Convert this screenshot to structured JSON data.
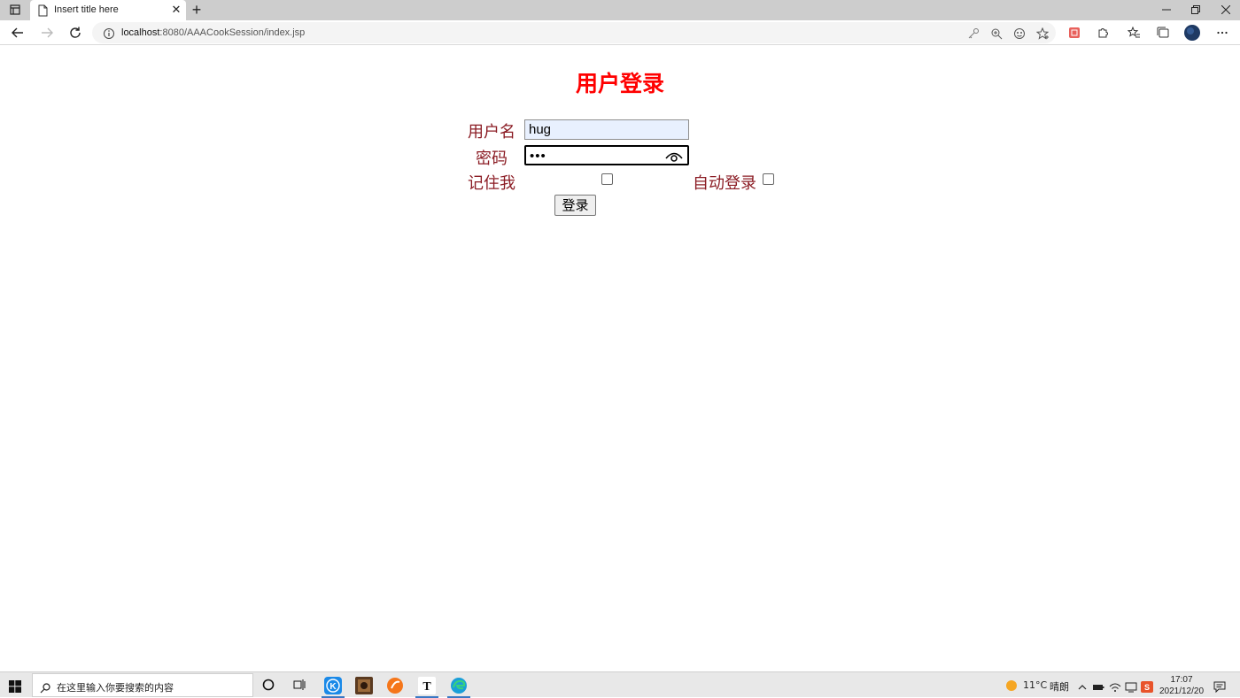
{
  "browser": {
    "tab_title": "Insert title here",
    "url_host": "localhost",
    "url_rest": ":8080/AAACookSession/index.jsp"
  },
  "page": {
    "title": "用户登录",
    "username_label": "用户名",
    "username_value": "hug",
    "password_label": "密码",
    "password_value": "•••",
    "remember_label": "记住我",
    "remember_checked": false,
    "autologin_label": "自动登录",
    "autologin_checked": false,
    "submit_label": "登录"
  },
  "taskbar": {
    "search_placeholder": "在这里输入你要搜索的内容",
    "weather_temp": "11°C",
    "weather_desc": "晴朗",
    "time": "17:07",
    "date": "2021/12/20"
  },
  "colors": {
    "title": "#ff0000",
    "label": "#8b1c24",
    "autofill": "#e8f0fe"
  }
}
